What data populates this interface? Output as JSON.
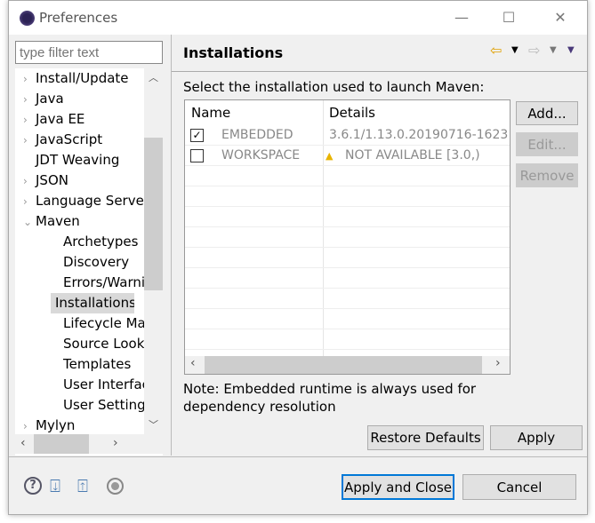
{
  "window": {
    "title": "Preferences",
    "minimize": "—",
    "maximize": "☐",
    "close": "✕"
  },
  "filter": {
    "placeholder": "type filter text"
  },
  "tree": [
    {
      "label": "Install/Update",
      "twisty": "›",
      "indent": 0
    },
    {
      "label": "Java",
      "twisty": "›",
      "indent": 0
    },
    {
      "label": "Java EE",
      "twisty": "›",
      "indent": 0
    },
    {
      "label": "JavaScript",
      "twisty": "›",
      "indent": 0
    },
    {
      "label": "JDT Weaving",
      "twisty": "",
      "indent": 0
    },
    {
      "label": "JSON",
      "twisty": "›",
      "indent": 0
    },
    {
      "label": "Language Server",
      "twisty": "›",
      "indent": 0
    },
    {
      "label": "Maven",
      "twisty": "⌄",
      "indent": 0
    },
    {
      "label": "Archetypes",
      "twisty": "",
      "indent": 1
    },
    {
      "label": "Discovery",
      "twisty": "",
      "indent": 1
    },
    {
      "label": "Errors/Warnin",
      "twisty": "",
      "indent": 1
    },
    {
      "label": "Installations",
      "twisty": "",
      "indent": 1,
      "selected": true
    },
    {
      "label": "Lifecycle Map",
      "twisty": "",
      "indent": 1
    },
    {
      "label": "Source Looku",
      "twisty": "",
      "indent": 1
    },
    {
      "label": "Templates",
      "twisty": "",
      "indent": 1
    },
    {
      "label": "User Interface",
      "twisty": "",
      "indent": 1
    },
    {
      "label": "User Settings",
      "twisty": "",
      "indent": 1
    },
    {
      "label": "Mylyn",
      "twisty": "›",
      "indent": 0
    }
  ],
  "page": {
    "title": "Installations",
    "description": "Select the installation used to launch Maven:",
    "note": "Note: Embedded runtime is always used for",
    "note2": "dependency resolution"
  },
  "table": {
    "columns": [
      "Name",
      "Details"
    ],
    "rows": [
      {
        "checked": true,
        "name": "EMBEDDED",
        "details": "3.6.1/1.13.0.20190716-1623",
        "warning": false
      },
      {
        "checked": false,
        "name": "WORKSPACE",
        "details": "NOT AVAILABLE [3.0,)",
        "warning": true
      }
    ]
  },
  "side_buttons": {
    "add": "Add...",
    "edit": "Edit...",
    "remove": "Remove"
  },
  "buttons": {
    "restore": "Restore Defaults",
    "apply": "Apply",
    "apply_close": "Apply and Close",
    "cancel": "Cancel"
  },
  "colors": {
    "accent": "#0078d7",
    "back_arrow": "#e0a000",
    "warning": "#e8b400"
  }
}
